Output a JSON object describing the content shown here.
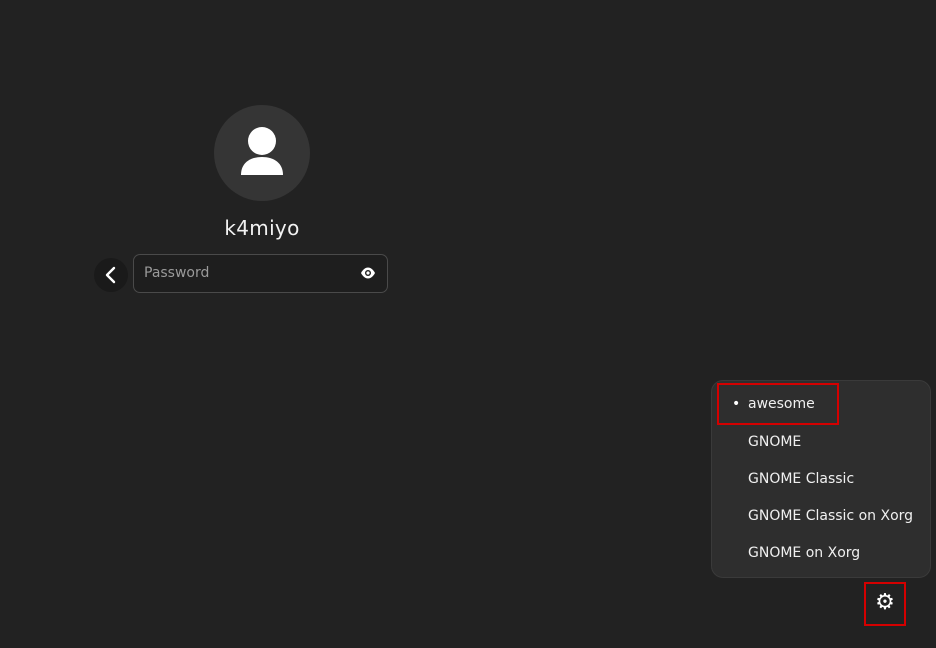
{
  "login": {
    "username": "k4miyo",
    "password_placeholder": "Password",
    "password_value": ""
  },
  "icons": {
    "avatar": "user-avatar-icon",
    "back": "chevron-left-icon",
    "reveal": "eye-icon",
    "settings": "gear-icon",
    "settings_glyph": "⚙",
    "bullet_glyph": "•"
  },
  "session_menu": {
    "items": [
      {
        "label": "awesome",
        "selected": true
      },
      {
        "label": "GNOME",
        "selected": false
      },
      {
        "label": "GNOME Classic",
        "selected": false
      },
      {
        "label": "GNOME Classic on Xorg",
        "selected": false
      },
      {
        "label": "GNOME on Xorg",
        "selected": false
      }
    ]
  },
  "colors": {
    "background": "#222222",
    "highlight": "#d40000",
    "menu_background": "#2e2e2e"
  }
}
